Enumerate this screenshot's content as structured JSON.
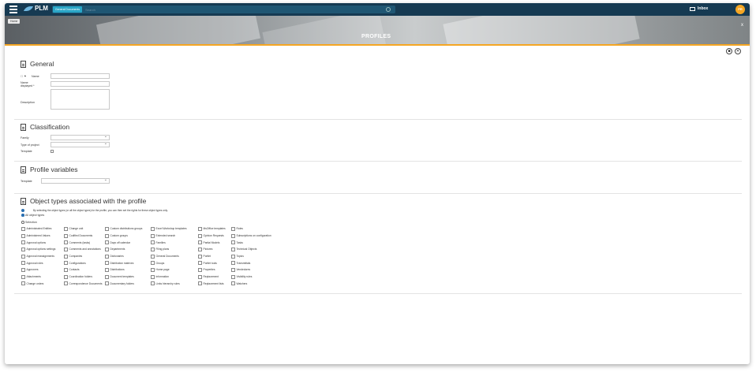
{
  "header": {
    "app_name": "PLM",
    "search_scope": "General Documents ",
    "search_placeholder": "Search",
    "inbox_label": "Inbox",
    "avatar_initials": "PR",
    "accent_color": "#f5a623",
    "topbar_color": "#163a52"
  },
  "banner": {
    "home_chip": "Home",
    "title": "PROFILES",
    "close_glyph": "x"
  },
  "actions": {
    "save_icon": "save-icon",
    "close_icon": "close-icon"
  },
  "general": {
    "title": "General",
    "name_label": "Name",
    "name_prefix": "☐ ⚑",
    "name_displayed_label_1": "Name",
    "name_displayed_label_2": "displayed *",
    "description_label": "Description"
  },
  "classification": {
    "title": "Classification",
    "family_label": "Family",
    "type_of_project_label": "Type of project",
    "template_label": "Template"
  },
  "profile_variables": {
    "title": "Profile variables",
    "template_label": "Template"
  },
  "object_types": {
    "title": "Object types associated with the profile",
    "info_text": "By selecting the object types (or all the object types) for the profile, you can then set the rights for these object types only.",
    "radio_all": "All object types",
    "radio_selection": "Selection",
    "columns": [
      [
        "Administrated Entities",
        "Administered Values",
        "Approval options",
        "Approval options settings",
        "Approval reassignments",
        "Approval roles",
        "Approvers",
        "Attachments",
        "Change orders"
      ],
      [
        "Change unit",
        "Codified Documents",
        "Comments (tasks)",
        "Comments and annotations",
        "Companies",
        "Configurations",
        "Contacts",
        "Coordination folders",
        "Correspondence Documents"
      ],
      [
        "Custom distributions groups",
        "Custom groups",
        "Days off calendar",
        "Departments",
        "Dictionaries",
        "Distribution matrixes",
        "Distributions",
        "Document templates",
        "Documentary folders"
      ],
      [
        "Excel Workshop templates",
        "Extended search",
        "Families",
        "Filing plans",
        "General Documents",
        "Groups",
        "Home page",
        "Information",
        "Links hierarchy rules"
      ],
      [
        "MsOffice templates",
        "Opinion Requests",
        "Partial Models",
        "Pictures",
        "Portlet",
        "Portlet tools",
        "Properties",
        "Replacement",
        "Replacement lists"
      ],
      [
        "Roles",
        "Subscriptions on configuration",
        "Tasks",
        "Technical Objects",
        "Topics",
        "Transmittals",
        "Vendedores",
        "Visibility rules",
        "Watchers"
      ]
    ]
  }
}
